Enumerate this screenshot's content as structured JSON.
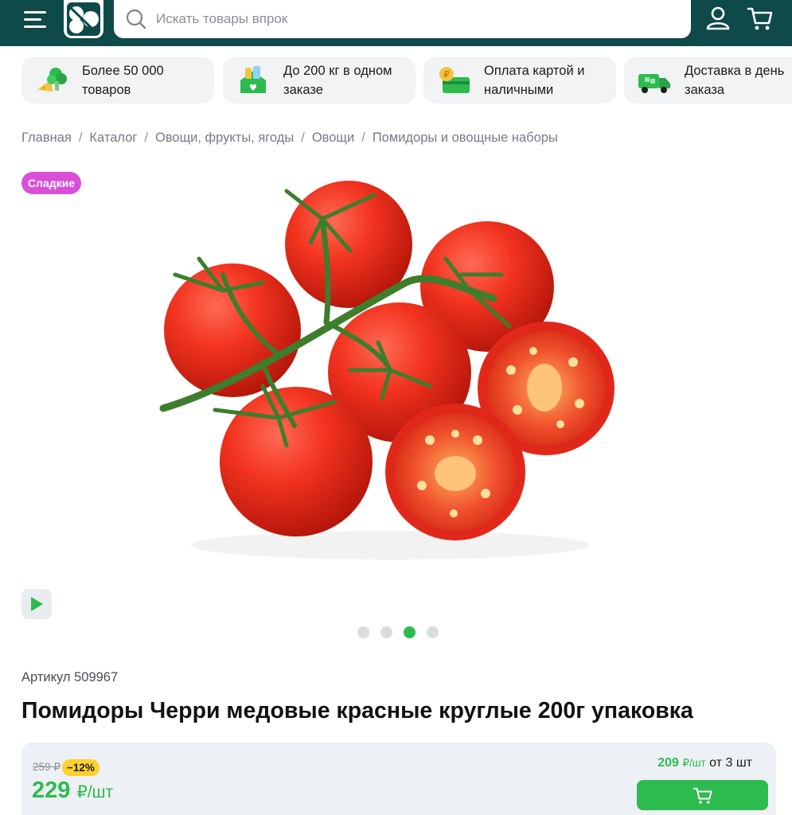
{
  "header": {
    "search_placeholder": "Искать товары впрок",
    "brand_color": "#0f4a4a",
    "icons": [
      "menu-icon",
      "logo",
      "search-icon",
      "user-icon",
      "cart-icon"
    ]
  },
  "features": [
    {
      "icon": "broccoli-cheese-icon",
      "label": "Более 50 000 товаров"
    },
    {
      "icon": "house-boxes-icon",
      "label": "До 200 кг в одном заказе"
    },
    {
      "icon": "card-coin-icon",
      "label": "Оплата картой и наличными"
    },
    {
      "icon": "delivery-truck-icon",
      "label": "Доставка в день заказа"
    }
  ],
  "breadcrumb": [
    "Главная",
    "Каталог",
    "Овощи, фрукты, ягоды",
    "Овощи",
    "Помидоры и овощные наборы"
  ],
  "badge": "Сладкие",
  "gallery": {
    "slides": 4,
    "active_index": 2
  },
  "product": {
    "sku": "Артикул 509967",
    "title": "Помидоры Черри медовые красные круглые 200г упаковка"
  },
  "price": {
    "old": "259 ₽",
    "discount": "−12%",
    "current": "229",
    "unit": "₽/шт",
    "bulk_price": "209",
    "bulk_unit": "₽/шт",
    "bulk_condition": "от 3 шт",
    "accent_color": "#2dbb4e"
  }
}
